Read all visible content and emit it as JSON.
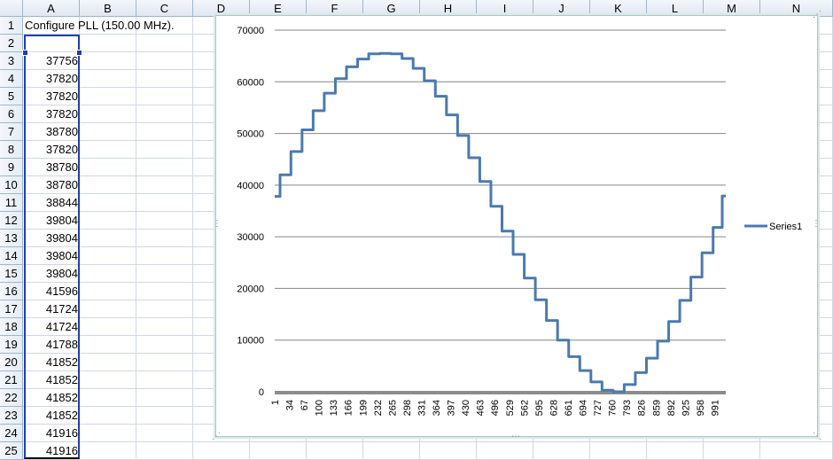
{
  "spreadsheet": {
    "columns": [
      "A",
      "B",
      "C",
      "D",
      "E",
      "F",
      "G",
      "H",
      "I",
      "J",
      "K",
      "L",
      "M",
      "N"
    ],
    "rows": [
      "1",
      "2",
      "3",
      "4",
      "5",
      "6",
      "7",
      "8",
      "9",
      "10",
      "11",
      "12",
      "13",
      "14",
      "15",
      "16",
      "17",
      "18",
      "19",
      "20",
      "21",
      "22",
      "23",
      "24",
      "25"
    ],
    "cells": {
      "A1": "Configure PLL (150.00 MHz).",
      "column_A_values": [
        "37756",
        "37820",
        "37820",
        "37820",
        "38780",
        "37820",
        "38780",
        "38780",
        "38844",
        "39804",
        "39804",
        "39804",
        "39804",
        "41596",
        "41724",
        "41724",
        "41788",
        "41852",
        "41852",
        "41852",
        "41852",
        "41916",
        "41916"
      ]
    }
  },
  "chart_data": {
    "type": "line",
    "legend_position": "right",
    "grid": true,
    "y_ticks": [
      "70000",
      "60000",
      "50000",
      "40000",
      "30000",
      "20000",
      "10000",
      "0"
    ],
    "ylim": [
      0,
      70000
    ],
    "x_tick_labels": [
      "1",
      "34",
      "67",
      "100",
      "133",
      "166",
      "199",
      "232",
      "265",
      "298",
      "331",
      "364",
      "397",
      "430",
      "463",
      "496",
      "529",
      "562",
      "595",
      "628",
      "661",
      "694",
      "727",
      "760",
      "793",
      "826",
      "859",
      "892",
      "925",
      "958",
      "991"
    ],
    "xlim": [
      1,
      1016
    ],
    "series": [
      {
        "name": "Series1",
        "color": "#4a7ab0",
        "x": [
          1,
          25,
          50,
          75,
          100,
          125,
          150,
          175,
          200,
          225,
          250,
          275,
          300,
          325,
          350,
          375,
          400,
          425,
          450,
          475,
          500,
          525,
          550,
          575,
          600,
          625,
          650,
          675,
          700,
          725,
          750,
          775,
          800,
          825,
          850,
          875,
          900,
          925,
          950,
          975,
          1000,
          1016
        ],
        "values": [
          37800,
          42000,
          46500,
          50700,
          54400,
          57800,
          60600,
          62900,
          64400,
          65400,
          65500,
          65400,
          64500,
          62600,
          60200,
          57200,
          53600,
          49600,
          45300,
          40700,
          35900,
          31100,
          26600,
          22000,
          17800,
          13800,
          10000,
          6800,
          4100,
          1900,
          300,
          0,
          1400,
          3700,
          6500,
          9800,
          13600,
          17700,
          22200,
          26900,
          31800,
          37900
        ]
      }
    ]
  }
}
